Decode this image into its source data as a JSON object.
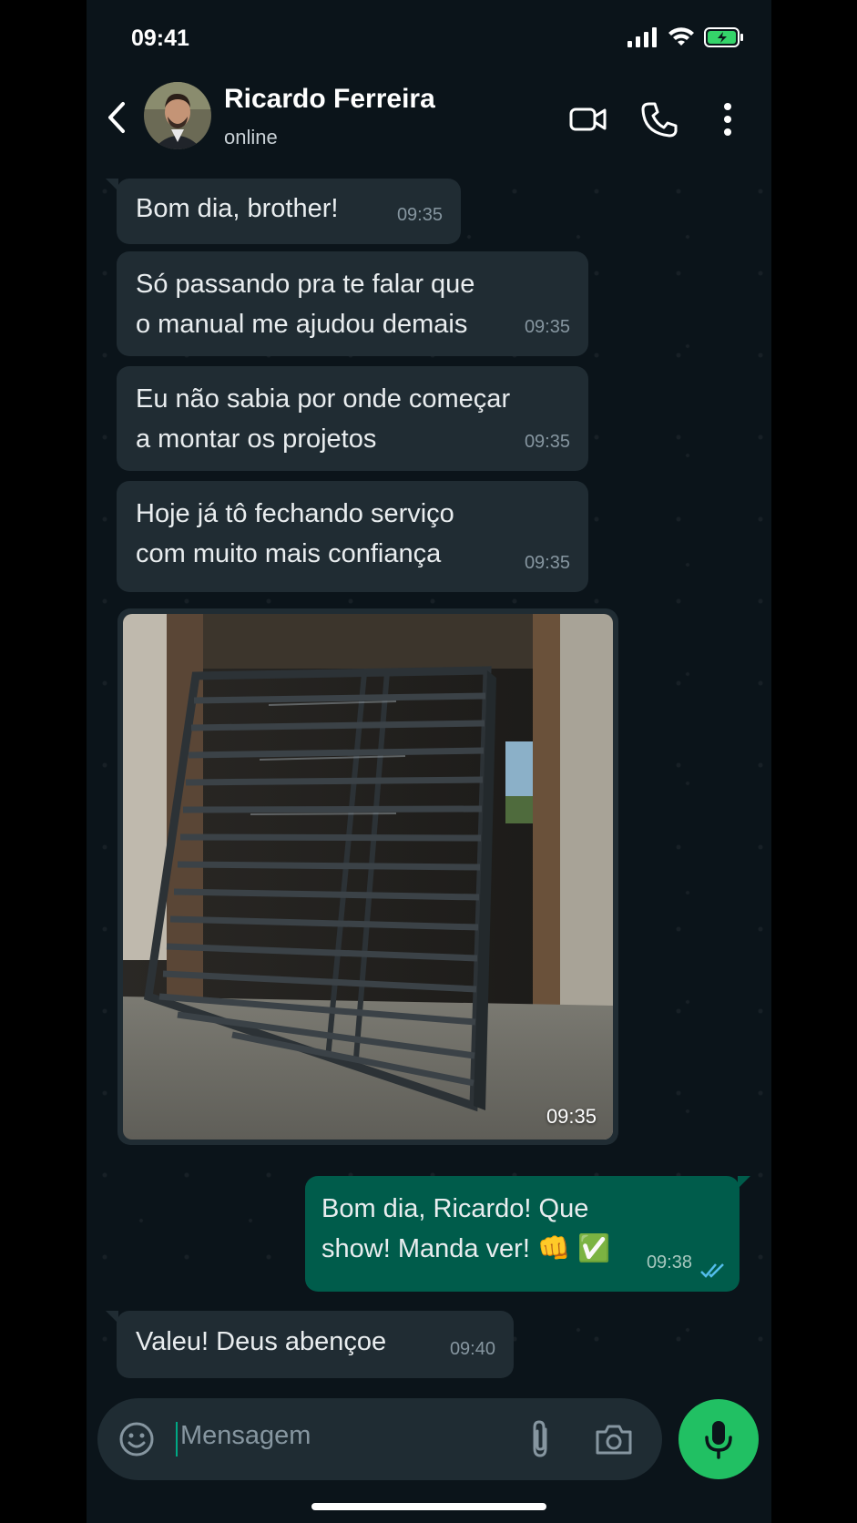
{
  "status_bar": {
    "time": "09:41",
    "battery_color": "#35d46a"
  },
  "chat_header": {
    "contact_name": "Ricardo Ferreira",
    "presence": "online"
  },
  "messages": [
    {
      "direction": "incoming",
      "text": "Bom dia, brother!",
      "time": "09:35"
    },
    {
      "direction": "incoming",
      "text": "Só passando pra te falar que\no manual me ajudou demais",
      "time": "09:35"
    },
    {
      "direction": "incoming",
      "text": "Eu não sabia por onde começar\na montar os projetos",
      "time": "09:35"
    },
    {
      "direction": "incoming",
      "text": "Hoje já tô fechando serviço\ncom muito mais confiança",
      "time": "09:35"
    },
    {
      "direction": "incoming",
      "type": "image",
      "time": "09:35"
    },
    {
      "direction": "outgoing",
      "text": "Bom dia, Ricardo! Que\nshow! Manda ver! 👊 ✅",
      "time": "09:38",
      "status": "read"
    },
    {
      "direction": "incoming",
      "text": "Valeu! Deus abençoe",
      "time": "09:40"
    }
  ],
  "composer": {
    "placeholder": "Mensagem"
  },
  "colors": {
    "accent": "#21c063",
    "outgoing_bubble": "#005c4b",
    "incoming_bubble": "#202c33",
    "read_ticks": "#53bdeb"
  },
  "icons": [
    "back-arrow-icon",
    "video-call-icon",
    "phone-icon",
    "more-options-icon",
    "emoji-icon",
    "attach-icon",
    "camera-icon",
    "mic-icon"
  ]
}
